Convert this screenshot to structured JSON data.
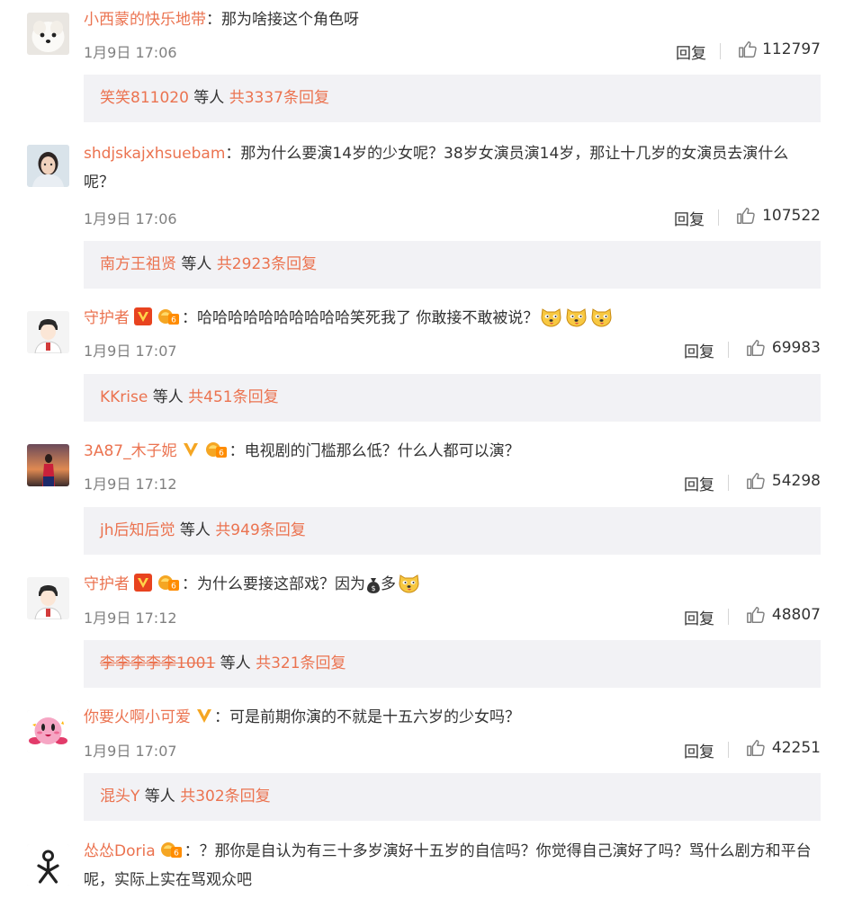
{
  "comments": [
    {
      "username": "小西蒙的快乐地带",
      "text": "：那为啥接这个角色呀",
      "time": "1月9日 17:06",
      "reply_label": "回复",
      "likes": "112797",
      "sub_reply": {
        "user": "笑笑811020",
        "mid": " 等人 ",
        "total": "共3337条回复"
      }
    },
    {
      "username": "shdjskajxhsuebam",
      "text": "：那为什么要演14岁的少女呢？38岁女演员演14岁，那让十几岁的女演员去演什么呢？",
      "time": "1月9日 17:06",
      "reply_label": "回复",
      "likes": "107522",
      "sub_reply": {
        "user": "南方王祖贤",
        "mid": " 等人 ",
        "total": "共2923条回复"
      }
    },
    {
      "username": "守护者",
      "text": "：哈哈哈哈哈哈哈哈哈哈笑死我了 你敢接不敢被说？",
      "time": "1月9日 17:07",
      "reply_label": "回复",
      "likes": "69983",
      "sub_reply": {
        "user": "KKrise",
        "mid": " 等人 ",
        "total": "共451条回复"
      }
    },
    {
      "username": "3A87_木子妮",
      "text": "：电视剧的门槛那么低？什么人都可以演？",
      "time": "1月9日 17:12",
      "reply_label": "回复",
      "likes": "54298",
      "sub_reply": {
        "user": "jh后知后觉",
        "mid": " 等人 ",
        "total": "共949条回复"
      }
    },
    {
      "username": "守护者",
      "text": "：为什么要接这部戏？因为",
      "text_after": "多",
      "time": "1月9日 17:12",
      "reply_label": "回复",
      "likes": "48807",
      "sub_reply": {
        "user": "李李李李李1001",
        "mid": " 等人 ",
        "total": "共321条回复"
      }
    },
    {
      "username": "你要火啊小可爱",
      "text": "：可是前期你演的不就是十五六岁的少女吗？",
      "time": "1月9日 17:07",
      "reply_label": "回复",
      "likes": "42251",
      "sub_reply": {
        "user": "混头Y",
        "mid": " 等人 ",
        "total": "共302条回复"
      }
    },
    {
      "username": "怂怂Doria",
      "text": "：？那你是自认为有三十多岁演好十五岁的自信吗？你觉得自己演好了吗？骂什么剧方和平台呢，实际上实在骂观众吧"
    }
  ],
  "colors": {
    "username": "#eb7350",
    "subbox_bg": "#f2f2f5",
    "verified": "#f5a623"
  }
}
